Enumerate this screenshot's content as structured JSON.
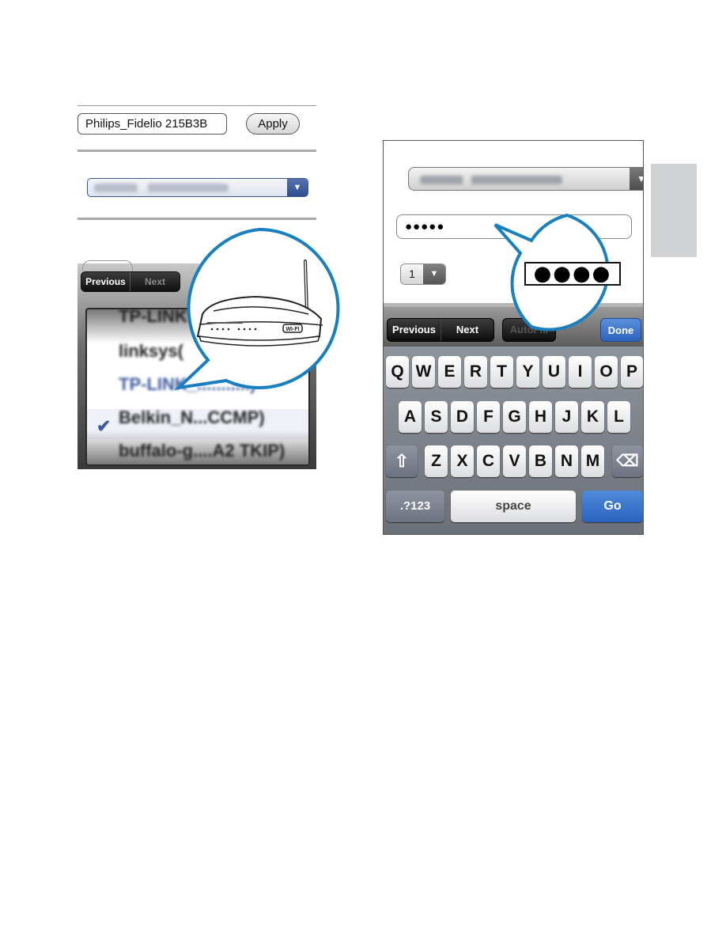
{
  "left_figure": {
    "device_name_field": {
      "value": "Philips_Fidelio 215B3B"
    },
    "apply_button": {
      "label": "Apply"
    },
    "network_select": {
      "value": "TP-LINK_(blurred)",
      "arrow": "▼"
    },
    "picker_toolbar": {
      "previous_label": "Previous",
      "next_label": "Next"
    },
    "picker_items": [
      {
        "label": "TP-LINK",
        "selected": false
      },
      {
        "label": "linksys(",
        "selected": false
      },
      {
        "label": "TP-LINK_...........)",
        "selected": true
      },
      {
        "label": "Belkin_N...CCMP)",
        "selected": false
      },
      {
        "label": "buffalo-g....A2 TKIP)",
        "selected": false
      }
    ],
    "check_mark": "✔",
    "callout": {
      "icon": "wifi-router-icon",
      "router_badge": "WI-FI"
    }
  },
  "right_figure": {
    "network_select": {
      "value": "TP-LINK_(blurred)",
      "arrow": "▼"
    },
    "password_field": {
      "value": "●●●●●"
    },
    "key_index_select": {
      "value": "1",
      "arrow": "▼"
    },
    "toolbar": {
      "previous_label": "Previous",
      "next_label": "Next",
      "autofill_label": "AutoFill",
      "done_label": "Done"
    },
    "callout_password": "●●●●",
    "keyboard": {
      "row1": [
        "Q",
        "W",
        "E",
        "R",
        "T",
        "Y",
        "U",
        "I",
        "O",
        "P"
      ],
      "row2": [
        "A",
        "S",
        "D",
        "F",
        "G",
        "H",
        "J",
        "K",
        "L"
      ],
      "row3": [
        "Z",
        "X",
        "C",
        "V",
        "B",
        "N",
        "M"
      ],
      "shift_icon": "⇧",
      "delete_icon": "⌫",
      "numbers_label": ".?123",
      "space_label": "space",
      "go_label": "Go"
    }
  },
  "colors": {
    "callout_blue": "#1a7fbf",
    "ios_blue": "#2d63bd",
    "select_blue": "#3a5590",
    "side_tab_gray": "#d0d2d3"
  }
}
